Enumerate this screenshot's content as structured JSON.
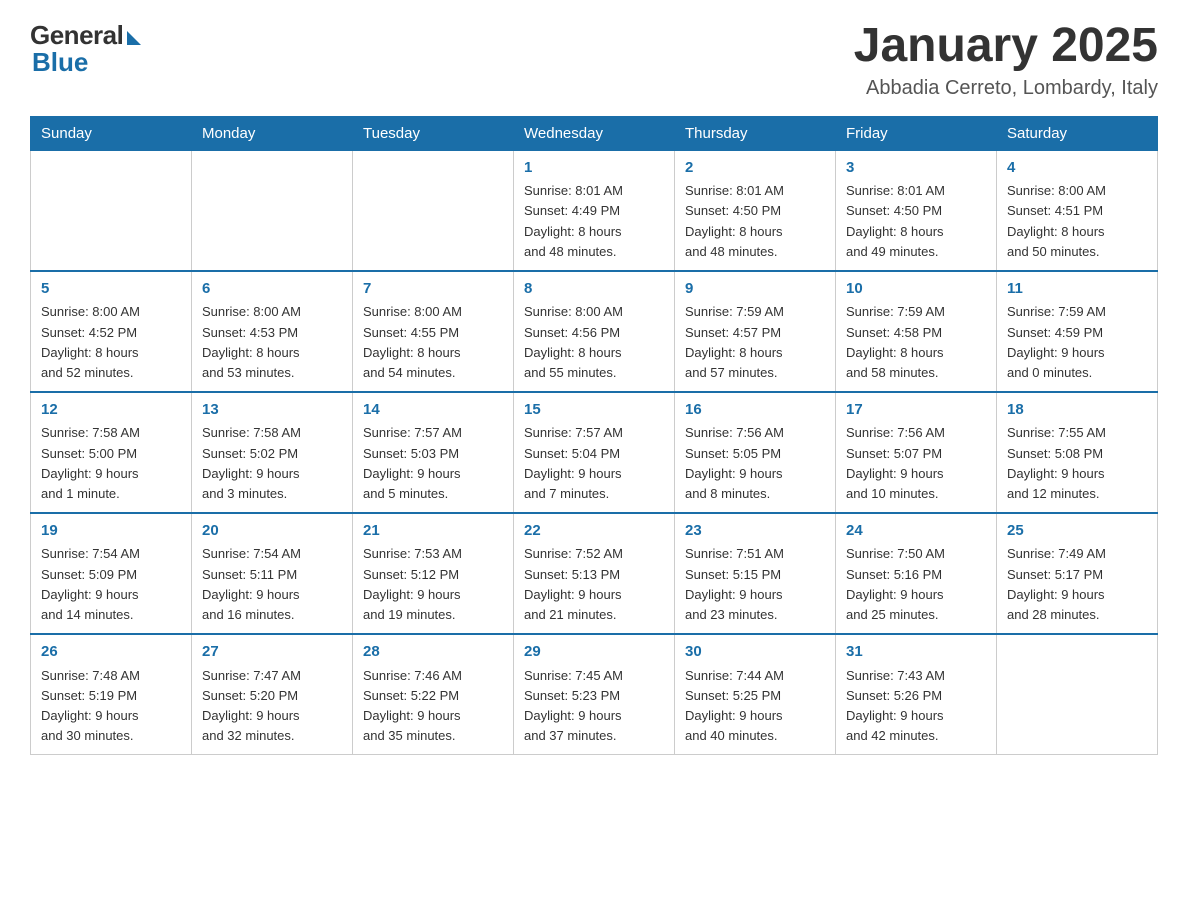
{
  "header": {
    "logo_general": "General",
    "logo_blue": "Blue",
    "month_year": "January 2025",
    "location": "Abbadia Cerreto, Lombardy, Italy"
  },
  "days_of_week": [
    "Sunday",
    "Monday",
    "Tuesday",
    "Wednesday",
    "Thursday",
    "Friday",
    "Saturday"
  ],
  "weeks": [
    [
      {
        "day": "",
        "info": ""
      },
      {
        "day": "",
        "info": ""
      },
      {
        "day": "",
        "info": ""
      },
      {
        "day": "1",
        "info": "Sunrise: 8:01 AM\nSunset: 4:49 PM\nDaylight: 8 hours\nand 48 minutes."
      },
      {
        "day": "2",
        "info": "Sunrise: 8:01 AM\nSunset: 4:50 PM\nDaylight: 8 hours\nand 48 minutes."
      },
      {
        "day": "3",
        "info": "Sunrise: 8:01 AM\nSunset: 4:50 PM\nDaylight: 8 hours\nand 49 minutes."
      },
      {
        "day": "4",
        "info": "Sunrise: 8:00 AM\nSunset: 4:51 PM\nDaylight: 8 hours\nand 50 minutes."
      }
    ],
    [
      {
        "day": "5",
        "info": "Sunrise: 8:00 AM\nSunset: 4:52 PM\nDaylight: 8 hours\nand 52 minutes."
      },
      {
        "day": "6",
        "info": "Sunrise: 8:00 AM\nSunset: 4:53 PM\nDaylight: 8 hours\nand 53 minutes."
      },
      {
        "day": "7",
        "info": "Sunrise: 8:00 AM\nSunset: 4:55 PM\nDaylight: 8 hours\nand 54 minutes."
      },
      {
        "day": "8",
        "info": "Sunrise: 8:00 AM\nSunset: 4:56 PM\nDaylight: 8 hours\nand 55 minutes."
      },
      {
        "day": "9",
        "info": "Sunrise: 7:59 AM\nSunset: 4:57 PM\nDaylight: 8 hours\nand 57 minutes."
      },
      {
        "day": "10",
        "info": "Sunrise: 7:59 AM\nSunset: 4:58 PM\nDaylight: 8 hours\nand 58 minutes."
      },
      {
        "day": "11",
        "info": "Sunrise: 7:59 AM\nSunset: 4:59 PM\nDaylight: 9 hours\nand 0 minutes."
      }
    ],
    [
      {
        "day": "12",
        "info": "Sunrise: 7:58 AM\nSunset: 5:00 PM\nDaylight: 9 hours\nand 1 minute."
      },
      {
        "day": "13",
        "info": "Sunrise: 7:58 AM\nSunset: 5:02 PM\nDaylight: 9 hours\nand 3 minutes."
      },
      {
        "day": "14",
        "info": "Sunrise: 7:57 AM\nSunset: 5:03 PM\nDaylight: 9 hours\nand 5 minutes."
      },
      {
        "day": "15",
        "info": "Sunrise: 7:57 AM\nSunset: 5:04 PM\nDaylight: 9 hours\nand 7 minutes."
      },
      {
        "day": "16",
        "info": "Sunrise: 7:56 AM\nSunset: 5:05 PM\nDaylight: 9 hours\nand 8 minutes."
      },
      {
        "day": "17",
        "info": "Sunrise: 7:56 AM\nSunset: 5:07 PM\nDaylight: 9 hours\nand 10 minutes."
      },
      {
        "day": "18",
        "info": "Sunrise: 7:55 AM\nSunset: 5:08 PM\nDaylight: 9 hours\nand 12 minutes."
      }
    ],
    [
      {
        "day": "19",
        "info": "Sunrise: 7:54 AM\nSunset: 5:09 PM\nDaylight: 9 hours\nand 14 minutes."
      },
      {
        "day": "20",
        "info": "Sunrise: 7:54 AM\nSunset: 5:11 PM\nDaylight: 9 hours\nand 16 minutes."
      },
      {
        "day": "21",
        "info": "Sunrise: 7:53 AM\nSunset: 5:12 PM\nDaylight: 9 hours\nand 19 minutes."
      },
      {
        "day": "22",
        "info": "Sunrise: 7:52 AM\nSunset: 5:13 PM\nDaylight: 9 hours\nand 21 minutes."
      },
      {
        "day": "23",
        "info": "Sunrise: 7:51 AM\nSunset: 5:15 PM\nDaylight: 9 hours\nand 23 minutes."
      },
      {
        "day": "24",
        "info": "Sunrise: 7:50 AM\nSunset: 5:16 PM\nDaylight: 9 hours\nand 25 minutes."
      },
      {
        "day": "25",
        "info": "Sunrise: 7:49 AM\nSunset: 5:17 PM\nDaylight: 9 hours\nand 28 minutes."
      }
    ],
    [
      {
        "day": "26",
        "info": "Sunrise: 7:48 AM\nSunset: 5:19 PM\nDaylight: 9 hours\nand 30 minutes."
      },
      {
        "day": "27",
        "info": "Sunrise: 7:47 AM\nSunset: 5:20 PM\nDaylight: 9 hours\nand 32 minutes."
      },
      {
        "day": "28",
        "info": "Sunrise: 7:46 AM\nSunset: 5:22 PM\nDaylight: 9 hours\nand 35 minutes."
      },
      {
        "day": "29",
        "info": "Sunrise: 7:45 AM\nSunset: 5:23 PM\nDaylight: 9 hours\nand 37 minutes."
      },
      {
        "day": "30",
        "info": "Sunrise: 7:44 AM\nSunset: 5:25 PM\nDaylight: 9 hours\nand 40 minutes."
      },
      {
        "day": "31",
        "info": "Sunrise: 7:43 AM\nSunset: 5:26 PM\nDaylight: 9 hours\nand 42 minutes."
      },
      {
        "day": "",
        "info": ""
      }
    ]
  ]
}
